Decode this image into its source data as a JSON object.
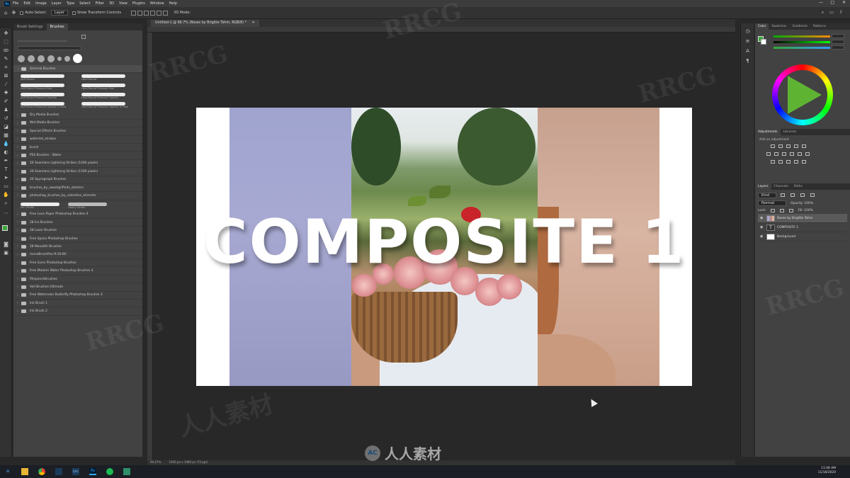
{
  "menubar": {
    "items": [
      "File",
      "Edit",
      "Image",
      "Layer",
      "Type",
      "Select",
      "Filter",
      "3D",
      "View",
      "Plugins",
      "Window",
      "Help"
    ],
    "window_controls": [
      "—",
      "□",
      "✕"
    ]
  },
  "options_bar": {
    "auto_select_label": "Auto-Select:",
    "auto_select_value": "Layer",
    "show_transform_label": "Show Transform Controls",
    "mode_label": "3D Mode:"
  },
  "document": {
    "tab_title": "Untitled-1 @ 66.7% (Roses by Brigitte Tohm, RGB/8) *",
    "zoom": "66.67%",
    "size_info": "1920 px x 1080 px (72 ppi)",
    "headline": "COMPOSITE 1"
  },
  "left_panel": {
    "tabs": [
      "Brush Settings",
      "Brushes"
    ],
    "general_group": "General Brushes",
    "strokes": [
      {
        "label": "Soft Round"
      },
      {
        "label": "Hard Round"
      },
      {
        "label": "Soft Round Pressure Size"
      },
      {
        "label": "Hard Round Pressure Size"
      },
      {
        "label": "Soft Round Pressure Opacity"
      },
      {
        "label": "Hard Round Pressure Opacity"
      },
      {
        "label": "Soft Round Pressure Opacity & Flow"
      },
      {
        "label": "Hard Round Pressure Opacity & Flow"
      }
    ],
    "folders_a": [
      "Dry Media Brushes",
      "Wet Media Brushes",
      "Special Effects Brushes",
      "waterink_strokes",
      "brush",
      "PS4 Brushes - Water",
      "26 Seamless Lightning Strikes (1000 pixels)",
      "26 Seamless Lightning Strikes (1500 pixels)",
      "26 Spyrograph Brushes",
      "brushes_by_sweetgrlfinds_starters",
      "photoshop_brushes_by_valentine_ehrenfer"
    ],
    "stroke_footer": [
      "Pen Stroke",
      "Heavy Stroke"
    ],
    "folders_b": [
      "Free Love Paper Photoshop Brushes 4",
      "28 Ice Brushes",
      "28 Laser Brushes",
      "Free Space Photoshop Brushes",
      "28 Monolith Brushes",
      "monoBrushRes-R-SS-B5",
      "Free Icons Photoshop Brushes",
      "Free Modern Water Photoshop Brushes 4",
      "filmpencilbrushes",
      "Vell Brushes Ultimate",
      "Free Watercolor Butterfly Photoshop Brushes 3",
      "Ink Brush 1",
      "Ink Brush 2"
    ]
  },
  "right_panel": {
    "color_tabs": [
      "Color",
      "Swatches",
      "Gradients",
      "Patterns"
    ],
    "adjustments_tabs": [
      "Adjustments",
      "Libraries"
    ],
    "adjustments_hint": "Add an adjustment",
    "layers_tabs": [
      "Layers",
      "Channels",
      "Paths"
    ],
    "kind_label": "Kind",
    "blend_mode": "Normal",
    "opacity": "Opacity: 100%",
    "lock_label": "Lock:",
    "fill": "Fill: 100%",
    "layers": [
      {
        "name": "Roses by Brigitte Tohm",
        "type": "image",
        "selected": true
      },
      {
        "name": "COMPOSITE 1",
        "type": "text",
        "selected": false
      },
      {
        "name": "Background",
        "type": "fill",
        "selected": false
      }
    ]
  },
  "taskbar": {
    "time": "11:08 AM",
    "date": "11/18/2020",
    "apps": [
      "File Explorer",
      "Chrome",
      "Lightroom",
      "Lrc",
      "Photoshop",
      "Spotify",
      "Mail"
    ]
  },
  "watermark": {
    "logo_text": "人人素材",
    "brand": "RRCG",
    "cn": "人人素材"
  },
  "colors": {
    "foreground": "#3aa53a",
    "background": "#ffffff",
    "accent": "#31a8ff"
  }
}
